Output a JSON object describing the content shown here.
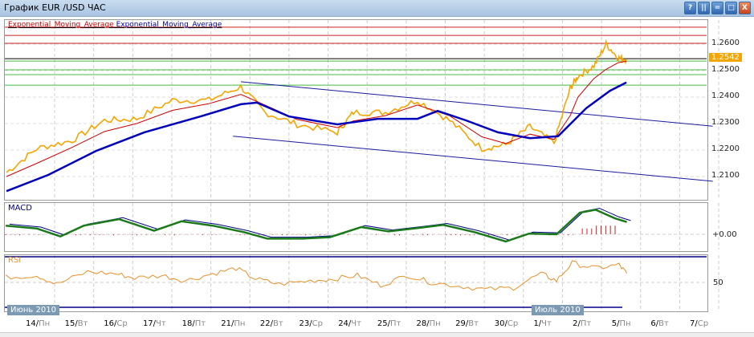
{
  "window": {
    "title": "График EUR /USD  ЧАС",
    "buttons": [
      "?",
      "||",
      "=",
      "□",
      "X"
    ]
  },
  "legend": {
    "ema1": "Exponential_Moving_Average",
    "ema2": "Exponential_Moving_Average",
    "ema1_color": "#cc0000",
    "ema2_color": "#0000aa"
  },
  "price_axis": {
    "labels": [
      "1.2600",
      "1.2500",
      "1.2400",
      "1.2300",
      "1.2200",
      "1.2100"
    ],
    "current": "1.2542"
  },
  "macd": {
    "label": "MACD",
    "axis": "+0.00"
  },
  "rsi": {
    "label": "RSI",
    "axis": "50"
  },
  "months": [
    "Июнь 2010",
    "Июль 2010"
  ],
  "ticks": [
    {
      "d": "14/",
      "w": "Пн"
    },
    {
      "d": "15/",
      "w": "Вт"
    },
    {
      "d": "16/",
      "w": "Ср"
    },
    {
      "d": "17/",
      "w": "Чт"
    },
    {
      "d": "18/",
      "w": "Пт"
    },
    {
      "d": "21/",
      "w": "Пн"
    },
    {
      "d": "22/",
      "w": "Вт"
    },
    {
      "d": "23/",
      "w": "Ср"
    },
    {
      "d": "24/",
      "w": "Чт"
    },
    {
      "d": "25/",
      "w": "Пт"
    },
    {
      "d": "28/",
      "w": "Пн"
    },
    {
      "d": "29/",
      "w": "Вт"
    },
    {
      "d": "30/",
      "w": "Ср"
    },
    {
      "d": "1/",
      "w": "Чт"
    },
    {
      "d": "2/",
      "w": "Пт"
    },
    {
      "d": "5/",
      "w": "Пн"
    },
    {
      "d": "6/",
      "w": "Вт"
    },
    {
      "d": "7/",
      "w": "Ср"
    }
  ],
  "chart_data": {
    "type": "line",
    "ylim": [
      1.2045,
      1.2675
    ],
    "xlim_days": [
      -0.8,
      17.3
    ],
    "price": [
      [
        -0.78,
        1.2115
      ],
      [
        0,
        1.2206
      ],
      [
        0.9,
        1.2236
      ],
      [
        1.73,
        1.2312
      ],
      [
        2.55,
        1.2318
      ],
      [
        3.47,
        1.2388
      ],
      [
        4.4,
        1.2388
      ],
      [
        5.22,
        1.2439
      ],
      [
        5.84,
        1.2342
      ],
      [
        6.66,
        1.2297
      ],
      [
        7.69,
        1.2267
      ],
      [
        8.1,
        1.2342
      ],
      [
        8.92,
        1.2342
      ],
      [
        9.74,
        1.2388
      ],
      [
        10.56,
        1.2312
      ],
      [
        11.39,
        1.2206
      ],
      [
        12,
        1.222
      ],
      [
        12.62,
        1.2288
      ],
      [
        13.24,
        1.2227
      ],
      [
        13.65,
        1.2433
      ],
      [
        13.85,
        1.2479
      ],
      [
        14.26,
        1.2518
      ],
      [
        14.57,
        1.26
      ],
      [
        14.88,
        1.2548
      ],
      [
        15.09,
        1.2542
      ]
    ],
    "ema_red": [
      [
        -0.78,
        1.21
      ],
      [
        0,
        1.215
      ],
      [
        0.9,
        1.221
      ],
      [
        1.73,
        1.227
      ],
      [
        2.55,
        1.23
      ],
      [
        3.47,
        1.235
      ],
      [
        4.4,
        1.2375
      ],
      [
        5.22,
        1.241
      ],
      [
        5.84,
        1.237
      ],
      [
        6.66,
        1.2315
      ],
      [
        7.69,
        1.2285
      ],
      [
        8.1,
        1.231
      ],
      [
        8.92,
        1.233
      ],
      [
        9.74,
        1.237
      ],
      [
        10.56,
        1.233
      ],
      [
        11.39,
        1.225
      ],
      [
        12,
        1.2225
      ],
      [
        12.62,
        1.226
      ],
      [
        13.24,
        1.224
      ],
      [
        13.65,
        1.233
      ],
      [
        13.85,
        1.24
      ],
      [
        14.26,
        1.247
      ],
      [
        14.57,
        1.2505
      ],
      [
        14.88,
        1.253
      ],
      [
        15.09,
        1.2535
      ]
    ],
    "ema_blue": [
      [
        -0.78,
        1.2045
      ],
      [
        0.29,
        1.2106
      ],
      [
        1.52,
        1.2197
      ],
      [
        2.75,
        1.2267
      ],
      [
        4.19,
        1.2327
      ],
      [
        5.22,
        1.2373
      ],
      [
        5.63,
        1.2379
      ],
      [
        6.45,
        1.2327
      ],
      [
        7.69,
        1.2297
      ],
      [
        8.72,
        1.2318
      ],
      [
        9.74,
        1.2318
      ],
      [
        10.26,
        1.2348
      ],
      [
        10.98,
        1.2312
      ],
      [
        11.8,
        1.2267
      ],
      [
        12.62,
        1.2245
      ],
      [
        13.34,
        1.2252
      ],
      [
        14.06,
        1.2358
      ],
      [
        14.67,
        1.2424
      ],
      [
        15.09,
        1.2455
      ]
    ],
    "channel_upper": [
      [
        5.22,
        1.2458
      ],
      [
        17.3,
        1.229
      ]
    ],
    "channel_lower": [
      [
        5.02,
        1.2252
      ],
      [
        17.3,
        1.2082
      ]
    ],
    "levels_red": [
      1.2664,
      1.2633,
      1.2603
    ],
    "level_black": 1.2545,
    "levels_green": [
      1.2536,
      1.2503,
      1.2485,
      1.2445
    ],
    "macd_line": [
      [
        -0.8,
        0.0012
      ],
      [
        0,
        0.0008
      ],
      [
        0.6,
        -0.0003
      ],
      [
        1.2,
        0.0012
      ],
      [
        2.1,
        0.0021
      ],
      [
        3.0,
        0.0005
      ],
      [
        3.7,
        0.0018
      ],
      [
        4.5,
        0.0012
      ],
      [
        5.3,
        0.0003
      ],
      [
        5.9,
        -0.0006
      ],
      [
        6.8,
        -0.0006
      ],
      [
        7.5,
        -0.0004
      ],
      [
        8.3,
        0.001
      ],
      [
        9.0,
        0.0004
      ],
      [
        9.8,
        0.0009
      ],
      [
        10.4,
        0.0013
      ],
      [
        11.2,
        0.0003
      ],
      [
        12,
        -0.001
      ],
      [
        12.6,
        0.0001
      ],
      [
        13.3,
        0.0
      ],
      [
        13.9,
        0.003
      ],
      [
        14.3,
        0.0034
      ],
      [
        14.8,
        0.0022
      ],
      [
        15.1,
        0.0017
      ]
    ],
    "rsi_line": [
      [
        -0.8,
        56
      ],
      [
        0,
        58
      ],
      [
        0.5,
        48
      ],
      [
        1.3,
        62
      ],
      [
        2.0,
        60
      ],
      [
        2.5,
        55
      ],
      [
        3.2,
        58
      ],
      [
        3.8,
        52
      ],
      [
        4.5,
        60
      ],
      [
        5.1,
        66
      ],
      [
        5.6,
        54
      ],
      [
        6.2,
        48
      ],
      [
        7.0,
        52
      ],
      [
        7.6,
        54
      ],
      [
        8.2,
        58
      ],
      [
        8.8,
        47
      ],
      [
        9.5,
        58
      ],
      [
        10.1,
        50
      ],
      [
        10.8,
        46
      ],
      [
        11.5,
        42
      ],
      [
        12.2,
        44
      ],
      [
        12.9,
        60
      ],
      [
        13.3,
        52
      ],
      [
        13.7,
        72
      ],
      [
        14.3,
        66
      ],
      [
        14.9,
        70
      ],
      [
        15.1,
        60
      ]
    ]
  }
}
